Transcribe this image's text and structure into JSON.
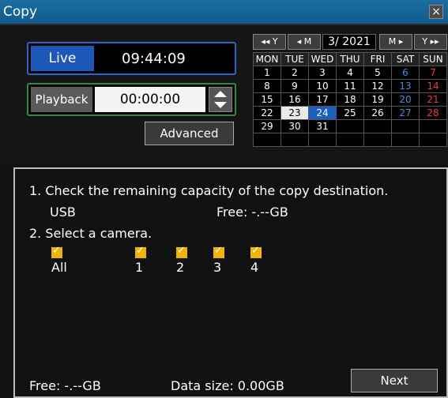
{
  "window": {
    "title": "Copy",
    "close_glyph": "×"
  },
  "live": {
    "label": "Live",
    "time": "09:44:09"
  },
  "playback": {
    "label": "Playback",
    "time": "00:00:00"
  },
  "advanced_label": "Advanced",
  "calendar": {
    "prev_year": "◂◂ Y",
    "prev_month": "◂ M",
    "month_year": "3/ 2021",
    "next_month": "M ▸",
    "next_year": "Y ▸▸",
    "weekdays": [
      "MON",
      "TUE",
      "WED",
      "THU",
      "FRI",
      "SAT",
      "SUN"
    ],
    "weeks": [
      [
        "1",
        "2",
        "3",
        "4",
        "5",
        "6",
        "7"
      ],
      [
        "8",
        "9",
        "10",
        "11",
        "12",
        "13",
        "14"
      ],
      [
        "15",
        "16",
        "17",
        "18",
        "19",
        "20",
        "21"
      ],
      [
        "22",
        "23",
        "24",
        "25",
        "26",
        "27",
        "28"
      ],
      [
        "29",
        "30",
        "31",
        "",
        "",
        "",
        ""
      ],
      [
        "",
        "",
        "",
        "",
        "",
        "",
        ""
      ]
    ],
    "today": "23",
    "selected": "24",
    "sat_color": "#4a8ad7",
    "sun_color": "#e0413a"
  },
  "steps": {
    "step1": "1. Check the remaining capacity of the copy destination.",
    "destination": "USB",
    "free_dest": "Free:   -.--GB",
    "step2": "2. Select a camera."
  },
  "cameras": [
    "All",
    "1",
    "2",
    "3",
    "4"
  ],
  "footer": {
    "free": "Free:   -.--GB",
    "data_size": "Data size: 0.00GB",
    "next_label": "Next"
  },
  "colors": {
    "accent": "#1d58b8",
    "titlebar": "#1c6ea2",
    "checkbox": "#f0b400"
  }
}
